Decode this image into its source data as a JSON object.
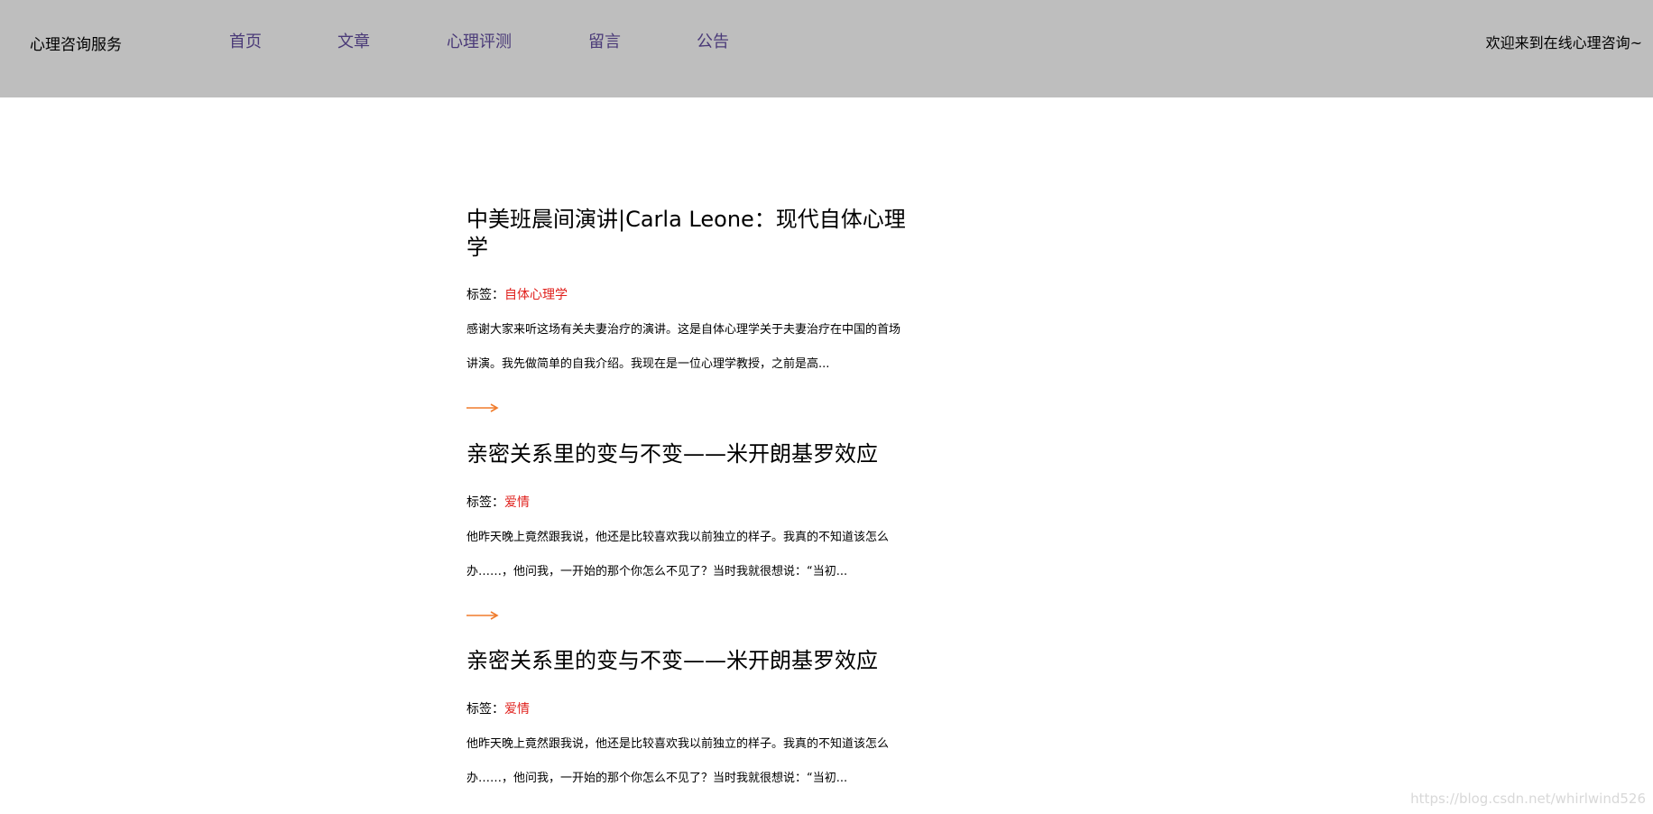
{
  "header": {
    "brand": "心理咨询服务",
    "nav": [
      {
        "label": "首页"
      },
      {
        "label": "文章"
      },
      {
        "label": "心理评测"
      },
      {
        "label": "留言"
      },
      {
        "label": "公告"
      }
    ],
    "welcome": "欢迎来到在线心理咨询~"
  },
  "articles": [
    {
      "title": "中美班晨间演讲|Carla Leone：现代自体心理学",
      "tag_label": "标签：",
      "tag": "自体心理学",
      "excerpt": "感谢大家来听这场有关夫妻治疗的演讲。这是自体心理学关于夫妻治疗在中国的首场讲演。我先做简单的自我介绍。我现在是一位心理学教授，之前是高..."
    },
    {
      "title": "亲密关系里的变与不变——米开朗基罗效应",
      "tag_label": "标签：",
      "tag": "爱情",
      "excerpt": "他昨天晚上竟然跟我说，他还是比较喜欢我以前独立的样子。我真的不知道该怎么办……，他问我，一开始的那个你怎么不见了？当时我就很想说：“当初..."
    },
    {
      "title": "亲密关系里的变与不变——米开朗基罗效应",
      "tag_label": "标签：",
      "tag": "爱情",
      "excerpt": "他昨天晚上竟然跟我说，他还是比较喜欢我以前独立的样子。我真的不知道该怎么办……，他问我，一开始的那个你怎么不见了？当时我就很想说：“当初..."
    }
  ],
  "watermark": "https://blog.csdn.net/whirlwind526",
  "colors": {
    "header_bg": "#bebebe",
    "nav_link": "#4a3a78",
    "tag": "#e0201c",
    "arrow": "#f07c2c"
  },
  "icons": {
    "more": "right-arrow-icon"
  }
}
